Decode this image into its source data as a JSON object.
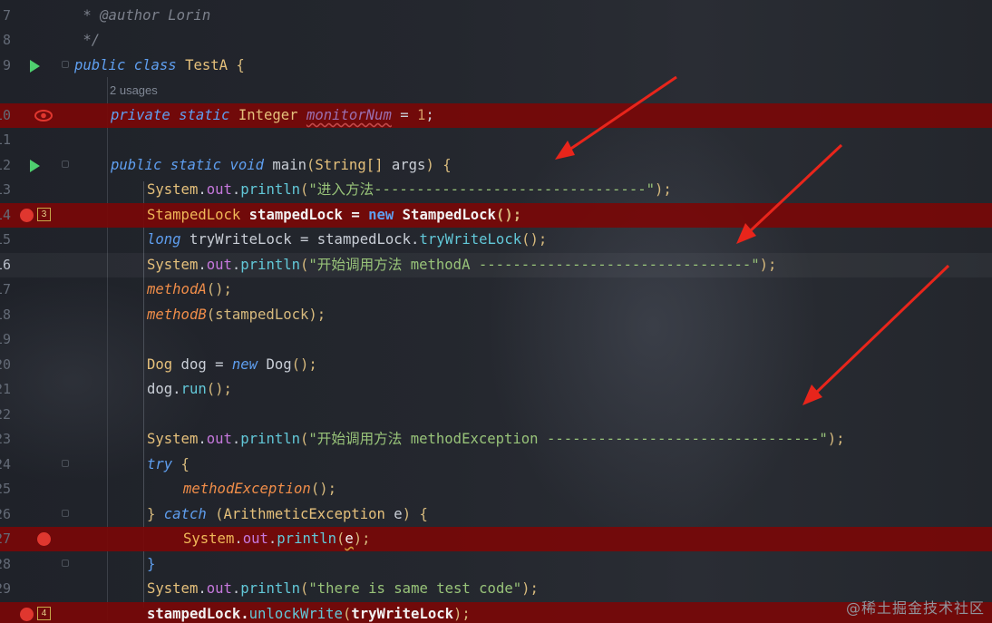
{
  "editor": {
    "usages_hint": "2 usages",
    "watermark": "@稀土掘金技术社区",
    "colors": {
      "breakpoint_line": "#7a0808",
      "breakpoint_dot": "#e0372f",
      "run_icon": "#4fcf6f",
      "arrow": "#e8251b"
    }
  },
  "gutter": {
    "line_numbers": [
      "7",
      "8",
      "9",
      "10",
      "11",
      "12",
      "13",
      "14",
      "15",
      "16",
      "17",
      "18",
      "19",
      "20",
      "21",
      "22",
      "23",
      "24",
      "25",
      "26",
      "27",
      "28",
      "29"
    ],
    "hit_counts": {
      "line14": "3",
      "line29": "4"
    },
    "icons": {
      "run": "run-icon",
      "breakpoint": "breakpoint-icon",
      "watch": "eye-icon"
    }
  },
  "code": {
    "l7": {
      "text": " * @author Lorin"
    },
    "l8": {
      "text": " */"
    },
    "l9": {
      "kw1": "public",
      "kw2": "class",
      "cls": "TestA",
      "rest": " {"
    },
    "l10": {
      "kw1": "private",
      "kw2": "static",
      "type": "Integer",
      "var": "monitorNum",
      "rest": " = ",
      "num": "1",
      "end": ";"
    },
    "l12": {
      "kw1": "public",
      "kw2": "static",
      "kw3": "void",
      "fn": "main",
      "p1": "(",
      "type": "String[]",
      "arg": " args",
      "p2": ") {"
    },
    "l13": {
      "sys": "System",
      "dot1": ".",
      "fld": "out",
      "dot2": ".",
      "fn": "println",
      "p1": "(",
      "str": "\"进入方法--------------------------------\"",
      "p2": ");"
    },
    "l14": {
      "type1": "StampedLock",
      "var": " stampedLock = ",
      "kw": "new",
      "type2": " StampedLock",
      "end": "();"
    },
    "l15": {
      "kw": "long",
      "var": " tryWriteLock = stampedLock.",
      "fn": "tryWriteLock",
      "end": "();"
    },
    "l16": {
      "sys": "System",
      "dot1": ".",
      "fld": "out",
      "dot2": ".",
      "fn": "println",
      "p1": "(",
      "str": "\"开始调用方法 methodA --------------------------------\"",
      "p2": ");"
    },
    "l17": {
      "sm": "methodA",
      "end": "();"
    },
    "l18": {
      "sm": "methodB",
      "end": "(stampedLock);"
    },
    "l20": {
      "type": "Dog",
      "var": " dog = ",
      "kw": "new",
      "type2": " Dog",
      "end": "();"
    },
    "l21": {
      "var": "dog.",
      "fn": "run",
      "end": "();"
    },
    "l23": {
      "sys": "System",
      "dot1": ".",
      "fld": "out",
      "dot2": ".",
      "fn": "println",
      "p1": "(",
      "str": "\"开始调用方法 methodException --------------------------------\"",
      "p2": ");"
    },
    "l24": {
      "kw": "try",
      "end": " {"
    },
    "l25": {
      "sm": "methodException",
      "end": "();"
    },
    "l26": {
      "b1": "} ",
      "kw": "catch",
      "p1": " (",
      "type": "ArithmeticException",
      "arg": " e",
      "p2": ") {"
    },
    "l27": {
      "sys": "System",
      "dot1": ".",
      "fld": "out",
      "dot2": ".",
      "fn": "println",
      "p1": "(",
      "arg": "e",
      "p2": ");"
    },
    "l28": {
      "text": "}"
    },
    "l29": {
      "sys": "System",
      "dot1": ".",
      "fld": "out",
      "dot2": ".",
      "fn": "println",
      "p1": "(",
      "str": "\"there is same test code\"",
      "p2": ");"
    },
    "l30": {
      "var": "stampedLock.",
      "fn": "unlockWrite",
      "p1": "(",
      "arg": "tryWriteLock",
      "p2": ");"
    }
  }
}
